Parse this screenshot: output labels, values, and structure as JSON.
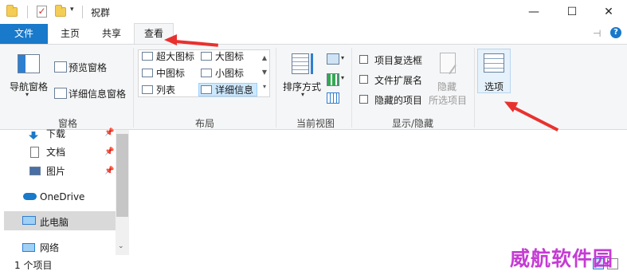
{
  "window": {
    "title": "祝群",
    "minimize_glyph": "—",
    "maximize_glyph": "☐",
    "close_glyph": "✕"
  },
  "tabs": {
    "file": "文件",
    "home": "主页",
    "share": "共享",
    "view": "查看",
    "help_glyph": "?",
    "pin_glyph": "⊣"
  },
  "ribbon": {
    "panes": {
      "nav_pane": "导航窗格",
      "preview_pane": "预览窗格",
      "details_pane": "详细信息窗格",
      "group_label": "窗格"
    },
    "layout": {
      "items": [
        "超大图标",
        "大图标",
        "中图标",
        "小图标",
        "列表",
        "详细信息"
      ],
      "selected": "详细信息",
      "group_label": "布局"
    },
    "current_view": {
      "sort_by": "排序方式",
      "group_label": "当前视图"
    },
    "show_hide": {
      "item_checkboxes": "项目复选框",
      "file_extensions": "文件扩展名",
      "hidden_items": "隐藏的项目",
      "hide": "隐藏",
      "selected_items": "所选项目",
      "group_label": "显示/隐藏"
    },
    "options": {
      "label": "选项"
    }
  },
  "nav": {
    "items": [
      {
        "label": "下载",
        "icon": "download-icon",
        "pinned": true
      },
      {
        "label": "文档",
        "icon": "document-icon",
        "pinned": true
      },
      {
        "label": "图片",
        "icon": "pictures-icon",
        "pinned": true
      },
      {
        "label": "OneDrive",
        "icon": "cloud-icon",
        "pinned": false
      },
      {
        "label": "此电脑",
        "icon": "computer-icon",
        "pinned": false,
        "selected": true
      },
      {
        "label": "网络",
        "icon": "network-icon",
        "pinned": false
      }
    ]
  },
  "status": {
    "item_count": "1 个项目"
  },
  "watermark": "威航软件园",
  "colors": {
    "accent": "#1979ca",
    "annotation_arrow": "#e8312f",
    "watermark": "#c12bd1"
  }
}
